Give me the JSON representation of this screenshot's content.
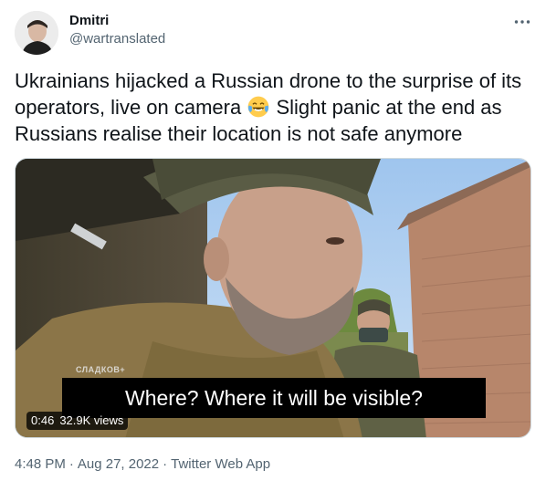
{
  "author": {
    "display_name": "Dmitri",
    "handle": "@wartranslated"
  },
  "icons": {
    "more": "more-horizontal-icon",
    "emoji": "face-with-tears-of-joy-emoji"
  },
  "tweet": {
    "text_before_emoji": "Ukrainians hijacked a Russian drone to the surprise of its operators, live on camera",
    "text_after_emoji": "Slight panic at the end as Russians realise their location is not safe anymore"
  },
  "media": {
    "watermark": "СЛАДКОВ+",
    "subtitle": "Where? Where it will be visible?",
    "duration": "0:46",
    "views": "32.9K views"
  },
  "footer": {
    "time": "4:48 PM",
    "date": "Aug 27, 2022",
    "separator": "·",
    "source": "Twitter Web App"
  },
  "colors": {
    "text_primary": "#0f1419",
    "text_secondary": "#536471",
    "border": "#cfd9de"
  }
}
